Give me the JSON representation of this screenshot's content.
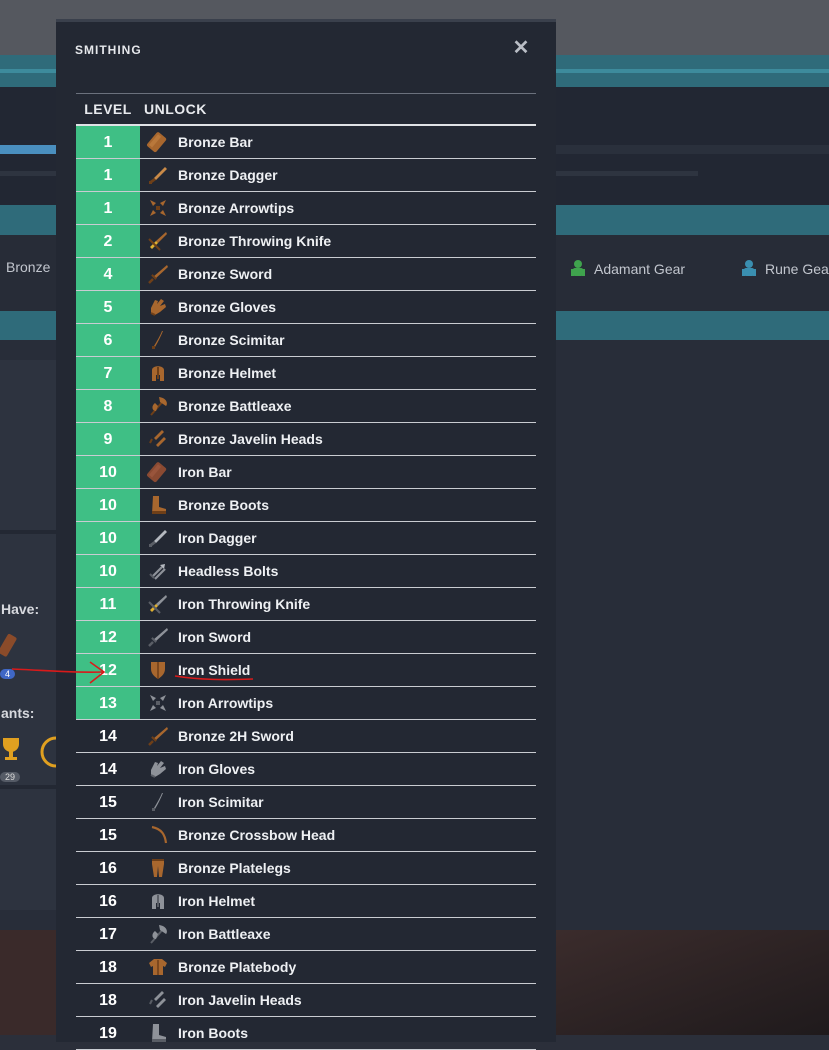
{
  "background": {
    "gear_tabs": [
      {
        "label": "Bronze",
        "icon": "gear-icon",
        "color": "#8b5a2b"
      },
      {
        "label": "Adamant Gear",
        "icon": "gear-icon",
        "color": "#3fa34d"
      },
      {
        "label": "Rune Gea",
        "icon": "gear-icon",
        "color": "#3a8fb0"
      }
    ],
    "have_label": "Have:",
    "ants_label": "ants:",
    "have_count": "4",
    "trophy_count": "29"
  },
  "modal": {
    "title": "SMITHING",
    "close_icon": "close-icon",
    "columns": {
      "level": "LEVEL",
      "unlock": "UNLOCK"
    },
    "colors": {
      "unlocked": "#3fbf85",
      "annotation": "#d91a1a"
    },
    "rows": [
      {
        "level": "1",
        "name": "Bronze Bar",
        "icon": "bar-icon",
        "metal": "bronze",
        "unlocked": true
      },
      {
        "level": "1",
        "name": "Bronze Dagger",
        "icon": "dagger-icon",
        "metal": "bronze",
        "unlocked": true
      },
      {
        "level": "1",
        "name": "Bronze Arrowtips",
        "icon": "arrowtips-icon",
        "metal": "bronze",
        "unlocked": true
      },
      {
        "level": "2",
        "name": "Bronze Throwing Knife",
        "icon": "throwing-knife-icon",
        "metal": "bronze",
        "unlocked": true
      },
      {
        "level": "4",
        "name": "Bronze Sword",
        "icon": "sword-icon",
        "metal": "bronze",
        "unlocked": true
      },
      {
        "level": "5",
        "name": "Bronze Gloves",
        "icon": "gloves-icon",
        "metal": "bronze",
        "unlocked": true
      },
      {
        "level": "6",
        "name": "Bronze Scimitar",
        "icon": "scimitar-icon",
        "metal": "bronze",
        "unlocked": true
      },
      {
        "level": "7",
        "name": "Bronze Helmet",
        "icon": "helmet-icon",
        "metal": "bronze",
        "unlocked": true
      },
      {
        "level": "8",
        "name": "Bronze Battleaxe",
        "icon": "battleaxe-icon",
        "metal": "bronze",
        "unlocked": true
      },
      {
        "level": "9",
        "name": "Bronze Javelin Heads",
        "icon": "javelin-heads-icon",
        "metal": "bronze",
        "unlocked": true
      },
      {
        "level": "10",
        "name": "Iron Bar",
        "icon": "bar-icon",
        "metal": "ironbar",
        "unlocked": true
      },
      {
        "level": "10",
        "name": "Bronze Boots",
        "icon": "boots-icon",
        "metal": "bronze",
        "unlocked": true
      },
      {
        "level": "10",
        "name": "Iron Dagger",
        "icon": "dagger-icon",
        "metal": "iron",
        "unlocked": true
      },
      {
        "level": "10",
        "name": "Headless Bolts",
        "icon": "bolts-icon",
        "metal": "iron",
        "unlocked": true
      },
      {
        "level": "11",
        "name": "Iron Throwing Knife",
        "icon": "throwing-knife-icon",
        "metal": "iron",
        "unlocked": true
      },
      {
        "level": "12",
        "name": "Iron Sword",
        "icon": "sword-icon",
        "metal": "iron",
        "unlocked": true
      },
      {
        "level": "12",
        "name": "Iron Shield",
        "icon": "shield-icon",
        "metal": "bronze",
        "unlocked": true
      },
      {
        "level": "13",
        "name": "Iron Arrowtips",
        "icon": "arrowtips-icon",
        "metal": "iron",
        "unlocked": true
      },
      {
        "level": "14",
        "name": "Bronze 2H Sword",
        "icon": "sword-icon",
        "metal": "bronze",
        "unlocked": false
      },
      {
        "level": "14",
        "name": "Iron Gloves",
        "icon": "gloves-icon",
        "metal": "iron",
        "unlocked": false
      },
      {
        "level": "15",
        "name": "Iron Scimitar",
        "icon": "scimitar-icon",
        "metal": "iron",
        "unlocked": false
      },
      {
        "level": "15",
        "name": "Bronze Crossbow Head",
        "icon": "crossbow-head-icon",
        "metal": "bronze",
        "unlocked": false
      },
      {
        "level": "16",
        "name": "Bronze Platelegs",
        "icon": "platelegs-icon",
        "metal": "bronze",
        "unlocked": false
      },
      {
        "level": "16",
        "name": "Iron Helmet",
        "icon": "helmet-icon",
        "metal": "iron",
        "unlocked": false
      },
      {
        "level": "17",
        "name": "Iron Battleaxe",
        "icon": "battleaxe-icon",
        "metal": "iron",
        "unlocked": false
      },
      {
        "level": "18",
        "name": "Bronze Platebody",
        "icon": "platebody-icon",
        "metal": "bronze",
        "unlocked": false
      },
      {
        "level": "18",
        "name": "Iron Javelin Heads",
        "icon": "javelin-heads-icon",
        "metal": "iron",
        "unlocked": false
      },
      {
        "level": "19",
        "name": "Iron Boots",
        "icon": "boots-icon",
        "metal": "iron",
        "unlocked": false
      }
    ]
  }
}
